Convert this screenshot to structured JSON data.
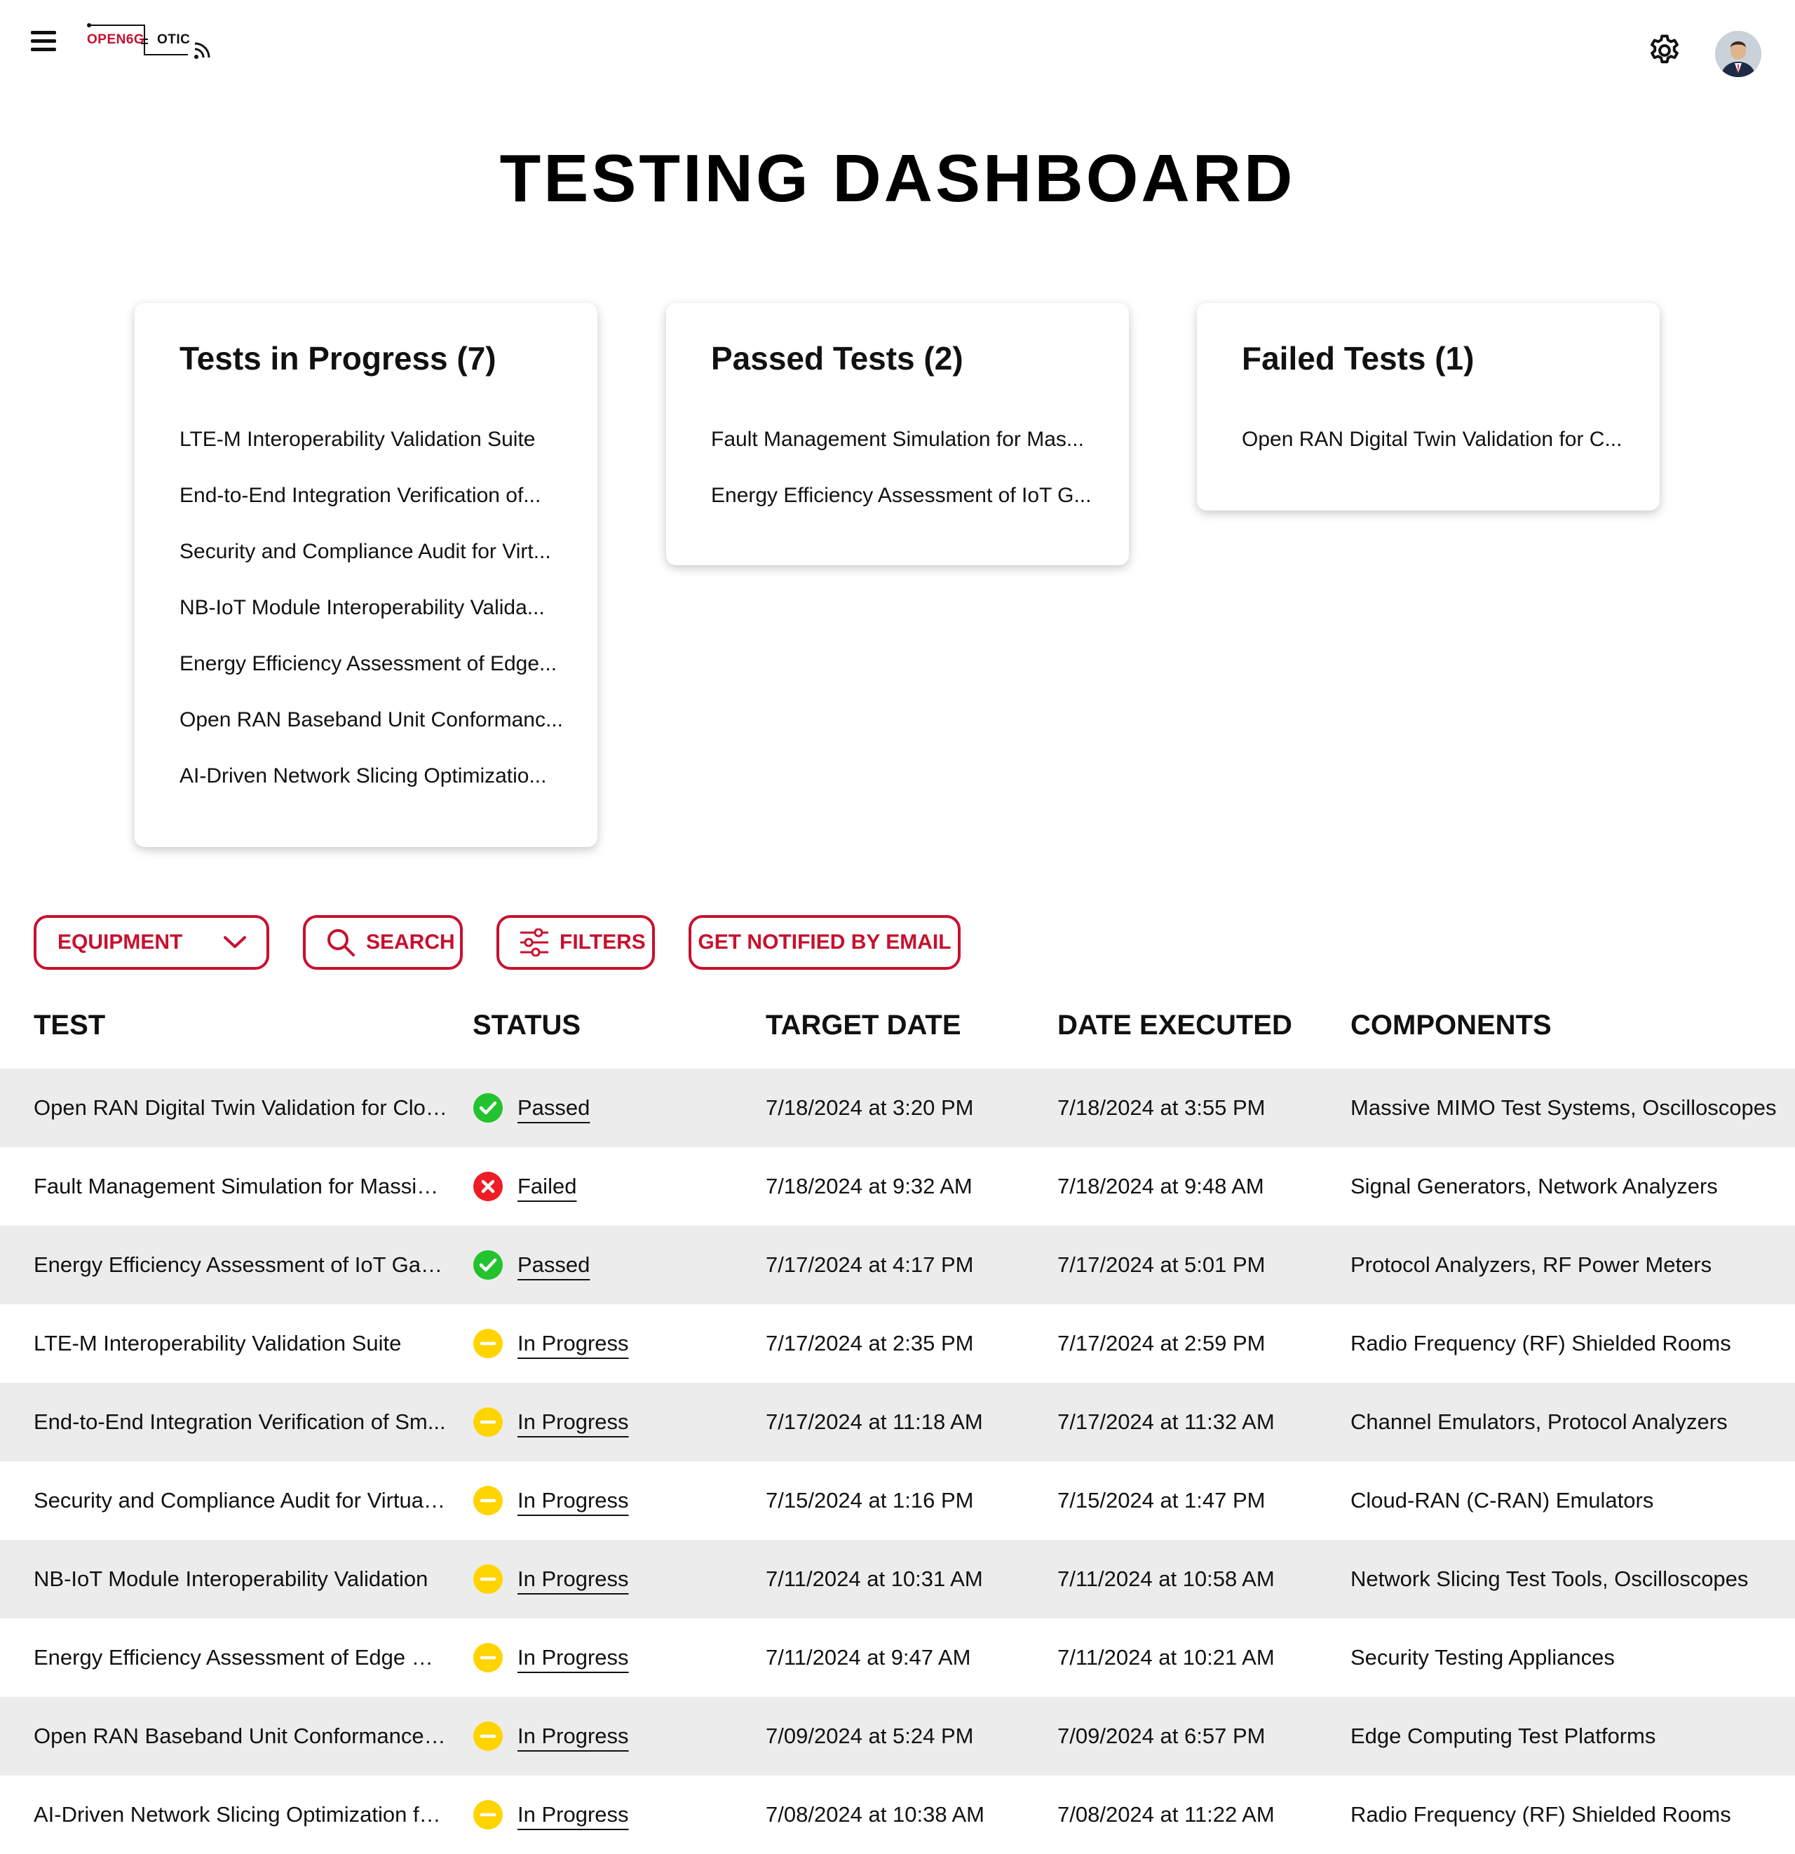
{
  "header": {
    "logo_left": "OPEN6G",
    "logo_right": "OTIC"
  },
  "page_title": "TESTING DASHBOARD",
  "cards": {
    "in_progress": {
      "title": "Tests in Progress (7)",
      "items": [
        "LTE-M Interoperability Validation Suite",
        "End-to-End Integration Verification of...",
        "Security and Compliance Audit for Virt...",
        "NB-IoT Module Interoperability Valida...",
        "Energy Efficiency Assessment of Edge...",
        "Open RAN Baseband Unit Conformanc...",
        "AI-Driven Network Slicing Optimizatio..."
      ]
    },
    "passed": {
      "title": "Passed Tests (2)",
      "items": [
        "Fault Management Simulation for Mas...",
        "Energy Efficiency Assessment of IoT G..."
      ]
    },
    "failed": {
      "title": "Failed Tests (1)",
      "items": [
        "Open RAN Digital Twin Validation for C..."
      ]
    }
  },
  "toolbar": {
    "equipment_label": "EQUIPMENT",
    "search_label": "SEARCH",
    "filters_label": "FILTERS",
    "notify_label": "GET NOTIFIED BY EMAIL"
  },
  "table": {
    "columns": [
      "TEST",
      "STATUS",
      "TARGET DATE",
      "DATE EXECUTED",
      "COMPONENTS"
    ],
    "rows": [
      {
        "test": "Open RAN Digital Twin Validation for Clou...",
        "status": "Passed",
        "status_type": "passed",
        "target": "7/18/2024 at 3:20 PM",
        "executed": "7/18/2024 at 3:55 PM",
        "components": "Massive MIMO Test Systems, Oscilloscopes"
      },
      {
        "test": "Fault Management Simulation for Massive...",
        "status": "Failed",
        "status_type": "failed",
        "target": "7/18/2024 at 9:32 AM",
        "executed": "7/18/2024 at 9:48 AM",
        "components": "Signal Generators, Network Analyzers"
      },
      {
        "test": "Energy Efficiency Assessment of IoT Gate...",
        "status": "Passed",
        "status_type": "passed",
        "target": "7/17/2024 at 4:17 PM",
        "executed": "7/17/2024 at 5:01 PM",
        "components": "Protocol Analyzers, RF Power Meters"
      },
      {
        "test": "LTE-M Interoperability Validation Suite",
        "status": "In Progress",
        "status_type": "progress",
        "target": "7/17/2024 at 2:35 PM",
        "executed": "7/17/2024 at 2:59 PM",
        "components": "Radio Frequency (RF) Shielded Rooms"
      },
      {
        "test": "End-to-End Integration Verification of Sm...",
        "status": "In Progress",
        "status_type": "progress",
        "target": "7/17/2024 at 11:18 AM",
        "executed": "7/17/2024 at 11:32 AM",
        "components": "Channel Emulators, Protocol Analyzers"
      },
      {
        "test": "Security and Compliance Audit for Virtuali...",
        "status": "In Progress",
        "status_type": "progress",
        "target": "7/15/2024 at 1:16 PM",
        "executed": "7/15/2024 at 1:47 PM",
        "components": "Cloud-RAN (C-RAN) Emulators"
      },
      {
        "test": "NB-IoT Module Interoperability Validation",
        "status": "In Progress",
        "status_type": "progress",
        "target": "7/11/2024 at 10:31 AM",
        "executed": "7/11/2024 at 10:58 AM",
        "components": "Network Slicing Test Tools, Oscilloscopes"
      },
      {
        "test": "Energy Efficiency Assessment of Edge Co...",
        "status": "In Progress",
        "status_type": "progress",
        "target": "7/11/2024 at 9:47 AM",
        "executed": "7/11/2024 at 10:21 AM",
        "components": "Security Testing Appliances"
      },
      {
        "test": "Open RAN Baseband Unit Conformance T...",
        "status": "In Progress",
        "status_type": "progress",
        "target": "7/09/2024 at 5:24 PM",
        "executed": "7/09/2024 at 6:57 PM",
        "components": "Edge Computing Test Platforms"
      },
      {
        "test": "AI-Driven Network Slicing Optimization fo...",
        "status": "In Progress",
        "status_type": "progress",
        "target": "7/08/2024 at 10:38 AM",
        "executed": "7/08/2024 at 11:22 AM",
        "components": "Radio Frequency (RF) Shielded Rooms"
      }
    ]
  },
  "colors": {
    "accent": "#c8102e",
    "passed": "#22c32e",
    "failed": "#ee1c25",
    "in_progress": "#ffd400",
    "row_alt": "#ececec"
  }
}
